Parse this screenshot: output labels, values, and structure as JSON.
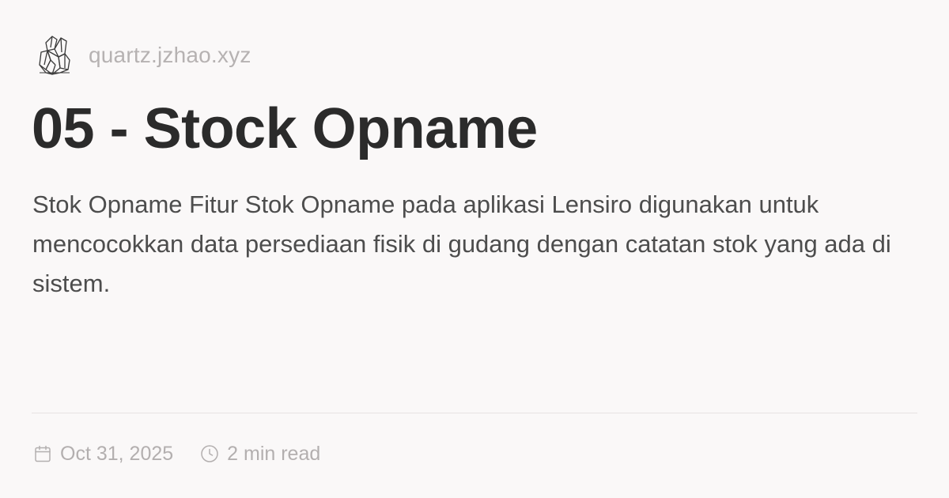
{
  "site": {
    "logo_icon": "crystal-logo-icon",
    "name": "quartz.jzhao.xyz"
  },
  "page": {
    "title": "05 - Stock Opname",
    "description": "Stok Opname Fitur Stok Opname pada aplikasi Lensiro digunakan untuk mencocokkan data persediaan fisik di gudang dengan catatan stok yang ada di sistem."
  },
  "meta": {
    "date_icon": "calendar-icon",
    "date": "Oct 31, 2025",
    "reading_time_icon": "clock-icon",
    "reading_time": "2 min read"
  },
  "colors": {
    "background": "#faf8f8",
    "title": "#2b2b2b",
    "description": "#4d4d4d",
    "muted": "#b3afaf",
    "divider": "#e6e3e3"
  }
}
